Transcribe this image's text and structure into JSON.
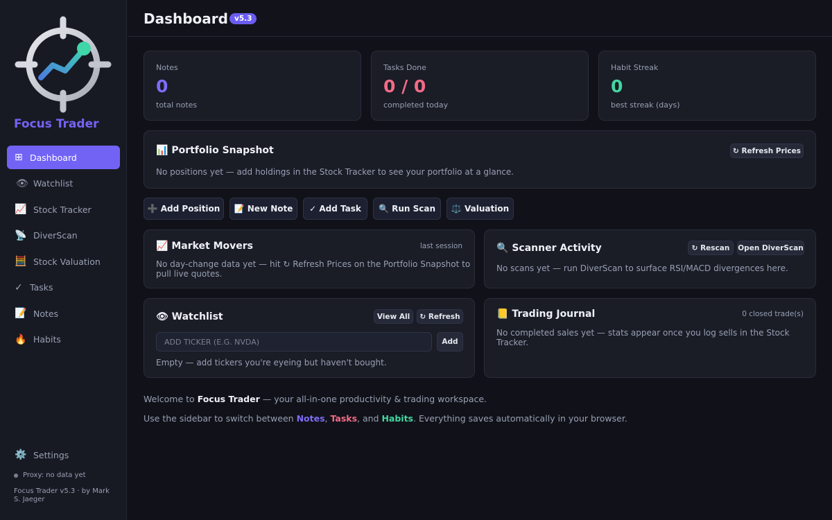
{
  "sidebar": {
    "brand": "Focus Trader",
    "nav": [
      {
        "icon": "⊞",
        "label": "Dashboard",
        "active": true
      },
      {
        "icon": "👁",
        "label": "Watchlist"
      },
      {
        "icon": "📈",
        "label": "Stock Tracker"
      },
      {
        "icon": "📡",
        "label": "DiverScan"
      },
      {
        "icon": "🧮",
        "label": "Stock Valuation"
      },
      {
        "icon": "✓",
        "label": "Tasks"
      },
      {
        "icon": "📝",
        "label": "Notes"
      },
      {
        "icon": "🔥",
        "label": "Habits"
      }
    ],
    "settings": {
      "icon": "⚙️",
      "label": "Settings"
    },
    "proxy_status": "Proxy: no data yet",
    "credits": "Focus Trader v5.3 · by Mark S. Jaeger"
  },
  "header": {
    "title": "Dashboard",
    "version": "v5.3"
  },
  "stats": {
    "notes": {
      "label": "Notes",
      "value": "0",
      "sub": "total notes",
      "color": "#7c6cf7"
    },
    "tasks": {
      "label": "Tasks Done",
      "value": "0 / 0",
      "sub": "completed today",
      "color": "#f26b86"
    },
    "habits": {
      "label": "Habit Streak",
      "value": "0",
      "sub": "best streak (days)",
      "color": "#43d6a0"
    }
  },
  "portfolio": {
    "icon": "📊",
    "title": "Portfolio Snapshot",
    "refresh_label": "↻ Refresh Prices",
    "empty_text": "No positions yet — add holdings in the Stock Tracker to see your portfolio at a glance."
  },
  "actions": [
    {
      "label": "➕ Add Position"
    },
    {
      "label": "📝 New Note"
    },
    {
      "label": "✓ Add Task"
    },
    {
      "label": "🔍 Run Scan"
    },
    {
      "label": "⚖️ Valuation"
    }
  ],
  "market_movers": {
    "icon": "📈",
    "title": "Market Movers",
    "note": "last session",
    "text_line1": "No day-change data yet — hit ↻ Refresh Prices on the Portfolio Snapshot to",
    "text_line2": "pull live quotes."
  },
  "scanner": {
    "icon": "🔍",
    "title": "Scanner Activity",
    "rescan_label": "↻ Rescan",
    "open_label": "Open DiverScan",
    "text": "No scans yet — run DiverScan to surface RSI/MACD divergences here."
  },
  "watchlist": {
    "icon": "👁",
    "title": "Watchlist",
    "view_all_label": "View All",
    "refresh_label": "↻ Refresh",
    "input_placeholder": "ADD TICKER (E.G. NVDA)",
    "add_label": "Add",
    "empty_text": "Empty — add tickers you're eyeing but haven't bought."
  },
  "journal": {
    "icon": "📒",
    "title": "Trading Journal",
    "note": "0 closed trade(s)",
    "text_line1": "No completed sales yet — stats appear once you log sells in the Stock",
    "text_line2": "Tracker."
  },
  "footer": {
    "line1_prefix": "Welcome to ",
    "line1_brand": "Focus Trader",
    "line1_suffix": " — your all-in-one productivity & trading workspace.",
    "line2_prefix": "Use the sidebar to switch between ",
    "notes_word": "Notes",
    "comma": ", ",
    "tasks_word": "Tasks",
    "and": ", and ",
    "habits_word": "Habits",
    "line2_suffix": ". Everything saves automatically in your browser."
  },
  "colors": {
    "accent": "#7263f5",
    "notes": "#7c6cf7",
    "tasks": "#f26b86",
    "habits": "#43d6a0"
  }
}
